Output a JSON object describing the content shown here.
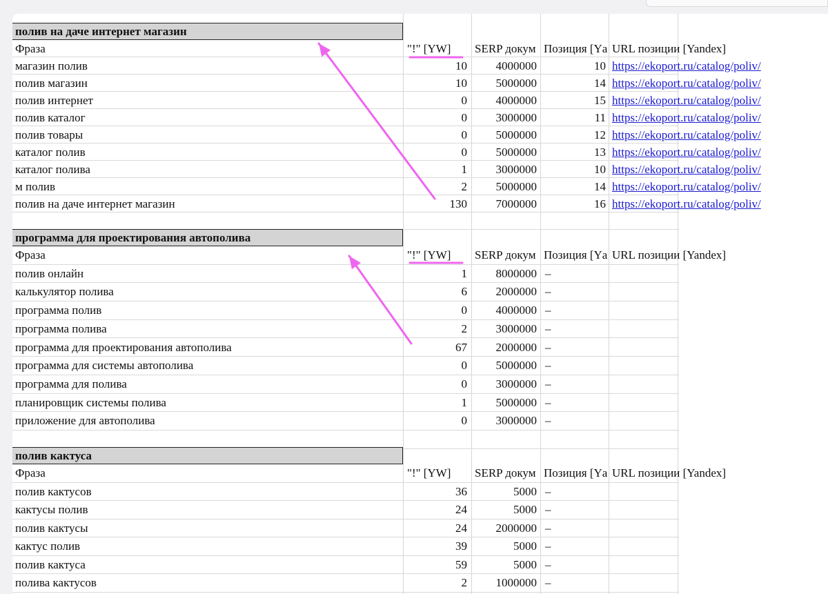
{
  "accent_colors": {
    "annotation": "#ee66ee",
    "link": "#1a1ad0",
    "title_bg": "#d4d4d4"
  },
  "sections": [
    {
      "title": "полив на даче интернет магазин",
      "headers": [
        "Фраза",
        "\"!\" [YW]",
        "SERP докум",
        "Позиция [Yа",
        "URL позиции [Yandex]"
      ],
      "rows": [
        [
          "магазин полив",
          "10",
          "4000000",
          "10",
          "https://ekoport.ru/catalog/poliv/"
        ],
        [
          "полив магазин",
          "10",
          "5000000",
          "14",
          "https://ekoport.ru/catalog/poliv/"
        ],
        [
          "полив интернет",
          "0",
          "4000000",
          "15",
          "https://ekoport.ru/catalog/poliv/"
        ],
        [
          "полив каталог",
          "0",
          "3000000",
          "11",
          "https://ekoport.ru/catalog/poliv/"
        ],
        [
          "полив товары",
          "0",
          "5000000",
          "12",
          "https://ekoport.ru/catalog/poliv/"
        ],
        [
          "каталог полив",
          "0",
          "5000000",
          "13",
          "https://ekoport.ru/catalog/poliv/"
        ],
        [
          "каталог полива",
          "1",
          "3000000",
          "10",
          "https://ekoport.ru/catalog/poliv/"
        ],
        [
          "м полив",
          "2",
          "5000000",
          "14",
          "https://ekoport.ru/catalog/poliv/"
        ],
        [
          "полив на даче интернет магазин",
          "130",
          "7000000",
          "16",
          "https://ekoport.ru/catalog/poliv/"
        ]
      ]
    },
    {
      "title": "программа для проектирования автополива",
      "headers": [
        "Фраза",
        "\"!\" [YW]",
        "SERP докум",
        "Позиция [Yа",
        "URL позиции [Yandex]"
      ],
      "rows": [
        [
          "полив онлайн",
          "1",
          "8000000",
          "–",
          ""
        ],
        [
          "калькулятор полива",
          "6",
          "2000000",
          "–",
          ""
        ],
        [
          "программа полив",
          "0",
          "4000000",
          "–",
          ""
        ],
        [
          "программа полива",
          "2",
          "3000000",
          "–",
          ""
        ],
        [
          "программа для проектирования автополива",
          "67",
          "2000000",
          "–",
          ""
        ],
        [
          "программа для системы автополива",
          "0",
          "5000000",
          "–",
          ""
        ],
        [
          "программа для полива",
          "0",
          "3000000",
          "–",
          ""
        ],
        [
          "планировщик системы полива",
          "1",
          "5000000",
          "–",
          ""
        ],
        [
          "приложение для автополива",
          "0",
          "3000000",
          "–",
          ""
        ]
      ]
    },
    {
      "title": "полив кактуса",
      "headers": [
        "Фраза",
        "\"!\" [YW]",
        "SERP докум",
        "Позиция [Yа",
        "URL позиции [Yandex]"
      ],
      "rows": [
        [
          "полив кактусов",
          "36",
          "5000",
          "–",
          ""
        ],
        [
          "кактусы полив",
          "24",
          "5000",
          "–",
          ""
        ],
        [
          "полив кактусы",
          "24",
          "2000000",
          "–",
          ""
        ],
        [
          "кактус полив",
          "39",
          "5000",
          "–",
          ""
        ],
        [
          "полив кактуса",
          "59",
          "5000",
          "–",
          ""
        ],
        [
          "полива кактусов",
          "2",
          "1000000",
          "–",
          ""
        ]
      ]
    }
  ]
}
